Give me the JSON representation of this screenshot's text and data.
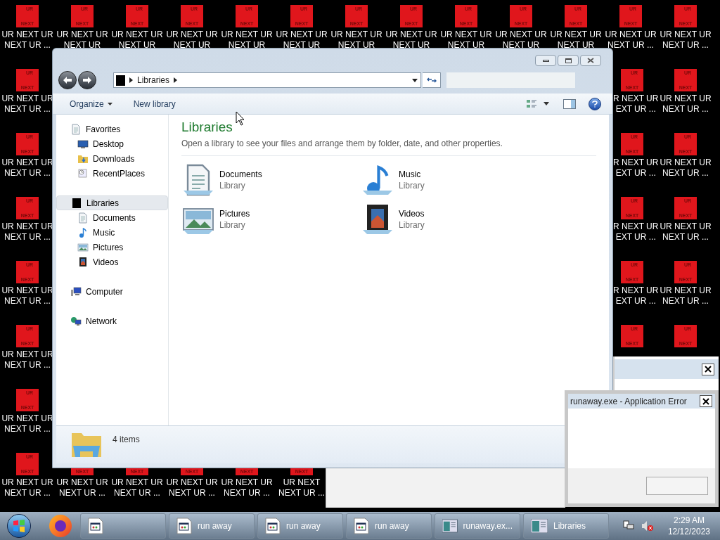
{
  "desktop_icons": [
    {
      "top": "UR",
      "bottom": "NEXT",
      "line1": "UR NEXT UR",
      "line2": "NEXT UR ..."
    },
    {
      "top": "UR",
      "bottom": "NEXT",
      "line1": "UR NEXT UR",
      "line2": "NEXT UR"
    },
    {
      "top": "UR",
      "bottom": "NEXT",
      "line1": "UR NEXT UR",
      "line2": "NEXT UR"
    },
    {
      "top": "UR",
      "bottom": "NEXT",
      "line1": "UR NEXT UR",
      "line2": "NEXT UR"
    },
    {
      "top": "UR",
      "bottom": "NEXT",
      "line1": "UR NEXT UR",
      "line2": "NEXT UR"
    },
    {
      "top": "UR",
      "bottom": "NEXT",
      "line1": "UR NEXT UR",
      "line2": "NEXT UR"
    },
    {
      "top": "UR",
      "bottom": "NEXT",
      "line1": "UR NEXT UR",
      "line2": "NEXT UR"
    },
    {
      "top": "UR",
      "bottom": "NEXT",
      "line1": "UR NEXT UR",
      "line2": "NEXT UR"
    },
    {
      "top": "UR",
      "bottom": "NEXT",
      "line1": "UR NEXT UR",
      "line2": "NEXT UR"
    },
    {
      "top": "UR",
      "bottom": "NEXT",
      "line1": "UR NEXT UR",
      "line2": "NEXT UR"
    },
    {
      "top": "UR",
      "bottom": "NEXT",
      "line1": "UR NEXT UR",
      "line2": "NEXT UR"
    },
    {
      "top": "UR",
      "bottom": "NEXT",
      "line1": "UR NEXT UR",
      "line2": "NEXT UR ..."
    },
    {
      "top": "UR",
      "bottom": "NEXT",
      "line1": "UR NEXT UR",
      "line2": "NEXT UR ..."
    },
    {
      "top": "UR",
      "bottom": "NEXT",
      "line1": "UR NEXT UR",
      "line2": "NEXT UR ..."
    },
    {
      "top": "UR",
      "bottom": "NEXT",
      "line1": "UR NEXT UR",
      "line2": "NEXT UR ..."
    },
    {
      "top": "UR",
      "bottom": "NEXT",
      "line1": "UR NEXT UR",
      "line2": "NEXT UR ..."
    },
    {
      "top": "UR",
      "bottom": "NEXT",
      "line1": "UR NEXT UR",
      "line2": "NEXT UR ..."
    },
    {
      "top": "UR",
      "bottom": "NEXT",
      "line1": "UR NEXT UR",
      "line2": "NEXT UR ..."
    },
    {
      "top": "UR",
      "bottom": "NEXT",
      "line1": "UR NEXT UR",
      "line2": "NEXT UR ..."
    },
    {
      "top": "UR",
      "bottom": "NEXT",
      "line1": "UR NEXT UR",
      "line2": "NEXT UR ..."
    },
    {
      "top": "UR",
      "bottom": "NEXT",
      "line1": "R NEXT UR",
      "line2": "EXT UR ..."
    },
    {
      "top": "UR",
      "bottom": "NEXT",
      "line1": "R NEXT UR",
      "line2": "EXT UR ..."
    },
    {
      "top": "UR",
      "bottom": "NEXT",
      "line1": "R NEXT UR",
      "line2": "EXT UR ..."
    },
    {
      "top": "UR",
      "bottom": "NEXT",
      "line1": "R NEXT UR",
      "line2": "EXT UR ..."
    },
    {
      "top": "UR",
      "bottom": "NEXT"
    },
    {
      "top": "UR",
      "bottom": "NEXT",
      "line1": "UR NEXT UR",
      "line2": "NEXT UR ..."
    },
    {
      "top": "UR",
      "bottom": "NEXT",
      "line1": "UR NEXT UR",
      "line2": "NEXT UR ..."
    },
    {
      "top": "UR",
      "bottom": "NEXT",
      "line1": "UR NEXT UR",
      "line2": "NEXT UR ..."
    },
    {
      "top": "UR",
      "bottom": "NEXT",
      "line1": "UR NEXT UR",
      "line2": "NEXT UR ..."
    },
    {
      "top": "UR",
      "bottom": "NEXT"
    },
    {
      "bottom": "NEXT",
      "line1": "UR NEXT UR",
      "line2": "NEXT UR ..."
    },
    {
      "bottom": "NEXT",
      "line1": "UR NEXT UR",
      "line2": "NEXT UR ..."
    },
    {
      "bottom": "NEXT",
      "line1": "UR NEXT UR",
      "line2": "NEXT UR ..."
    },
    {
      "bottom": "NEXT",
      "line1": "UR NEXT UR",
      "line2": "NEXT UR ..."
    },
    {
      "bottom": "NEXT",
      "line1": "UR NEXT",
      "line2": "NEXT UR ..."
    }
  ],
  "explorer": {
    "address": [
      "Libraries"
    ],
    "toolbar": [
      "Organize",
      "New library"
    ],
    "nav": [
      {
        "label": "Favorites",
        "kind": "favorites",
        "selected": false,
        "children": [
          {
            "label": "Desktop",
            "kind": "desktop",
            "selected": false
          },
          {
            "label": "Downloads",
            "kind": "downloads",
            "selected": false
          },
          {
            "label": "RecentPlaces",
            "kind": "recent",
            "selected": false
          }
        ]
      },
      {
        "label": "Libraries",
        "kind": "libraries",
        "selected": true,
        "children": [
          {
            "label": "Documents",
            "kind": "documents",
            "selected": false
          },
          {
            "label": "Music",
            "kind": "music",
            "selected": false
          },
          {
            "label": "Pictures",
            "kind": "pictures",
            "selected": false
          },
          {
            "label": "Videos",
            "kind": "videos",
            "selected": false
          }
        ]
      },
      {
        "label": "Computer",
        "kind": "computer",
        "selected": false
      },
      {
        "label": "Network",
        "kind": "network",
        "selected": false
      }
    ],
    "heading": "Libraries",
    "description": "Open a library to see your files and arrange them by folder, date, and other properties.",
    "libraries": [
      {
        "name": "Documents",
        "type": "Library",
        "kind": "documents"
      },
      {
        "name": "Music",
        "type": "Library",
        "kind": "music"
      },
      {
        "name": "Pictures",
        "type": "Library",
        "kind": "pictures"
      },
      {
        "name": "Videos",
        "type": "Library",
        "kind": "videos"
      }
    ],
    "status": "4 items"
  },
  "error_dialog": {
    "title": "runaway.exe - Application Error"
  },
  "taskbar": {
    "buttons": [
      {
        "kind": "program"
      },
      {
        "kind": "program",
        "label": "run away"
      },
      {
        "kind": "program",
        "label": "run away"
      },
      {
        "kind": "program",
        "label": "run away"
      },
      {
        "kind": "window",
        "label": "runaway.ex..."
      },
      {
        "kind": "window",
        "label": "Libraries"
      }
    ],
    "time": "2:29 AM",
    "date": "12/12/2023"
  }
}
